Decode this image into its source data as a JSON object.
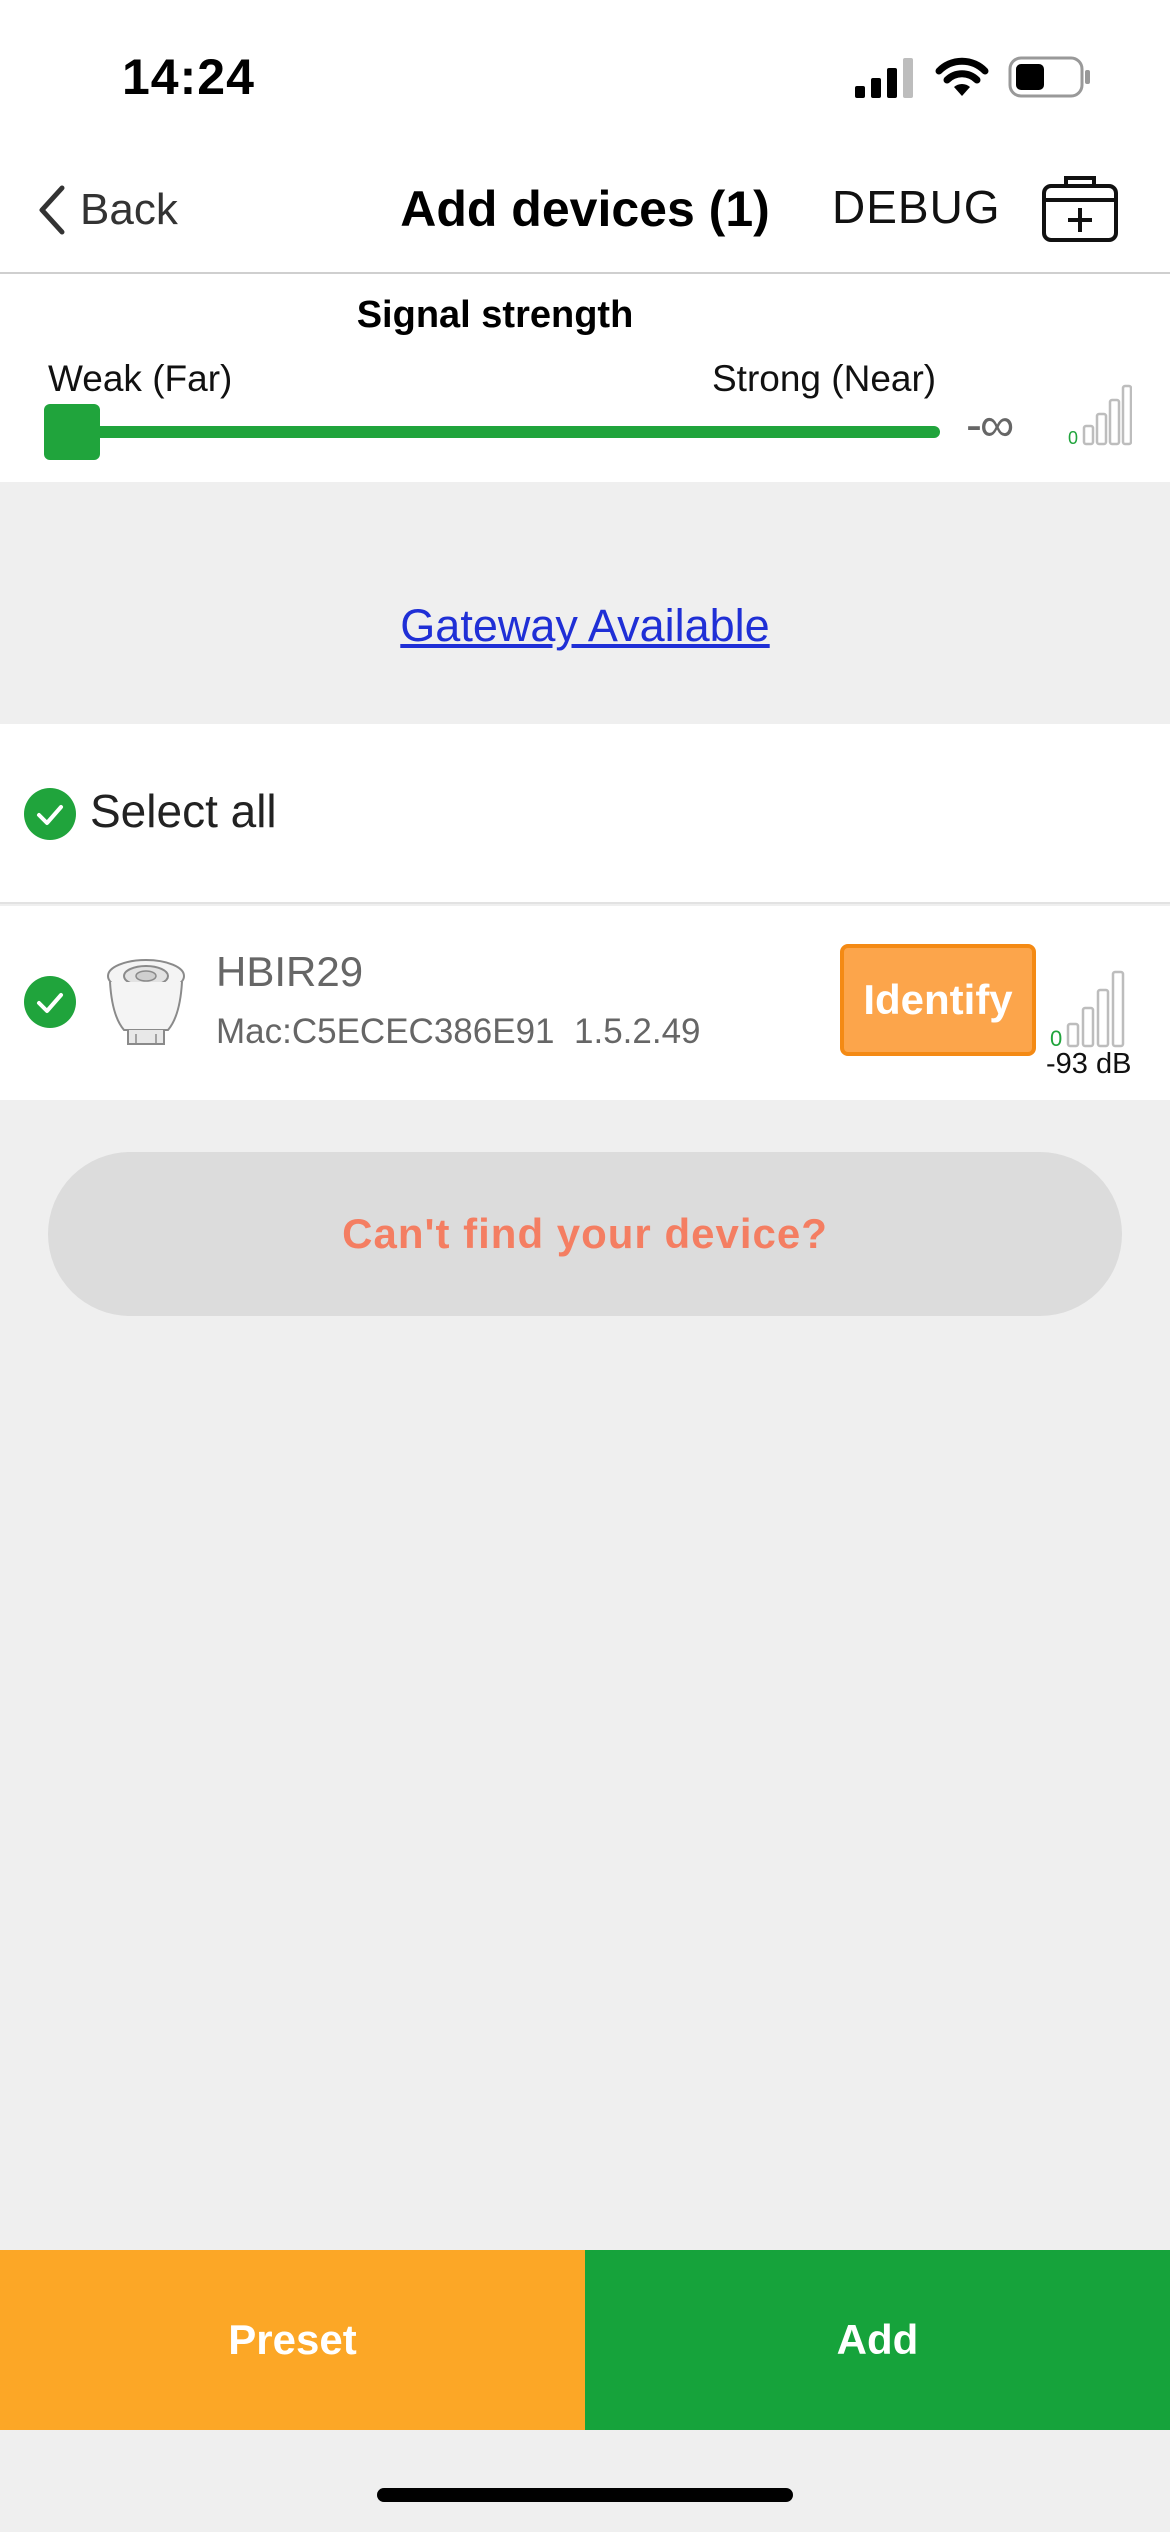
{
  "status_bar": {
    "time": "14:24",
    "icons": [
      "cellular-signal-icon",
      "wifi-icon",
      "battery-icon"
    ]
  },
  "nav": {
    "back_label": "Back",
    "title": "Add devices (1)",
    "debug_label": "DEBUG",
    "kit_icon": "first-aid-kit-icon"
  },
  "signal_filter": {
    "title": "Signal strength",
    "weak_label": "Weak (Far)",
    "strong_label": "Strong (Near)",
    "value_label": "-∞",
    "slider_position": 0,
    "bars_icon": "signal-bars-icon",
    "bars_count_label": "0"
  },
  "gateway_link": "Gateway Available",
  "select_all": {
    "label": "Select all",
    "checked": true
  },
  "devices": [
    {
      "name": "HBIR29",
      "mac": "Mac:C5ECEC386E91",
      "firmware": "1.5.2.49",
      "checked": true,
      "identify_label": "Identify",
      "rssi_label": "-93 dB",
      "bars_count_label": "0",
      "image_icon": "sensor-device-icon"
    }
  ],
  "cant_find_label": "Can't find your device?",
  "bottom_bar": {
    "preset_label": "Preset",
    "add_label": "Add"
  },
  "colors": {
    "green": "#16a33b",
    "orange": "#fca726",
    "identify_orange": "#fca54b",
    "link_blue": "#1f2fd6",
    "cant_find_text": "#f47e62"
  }
}
